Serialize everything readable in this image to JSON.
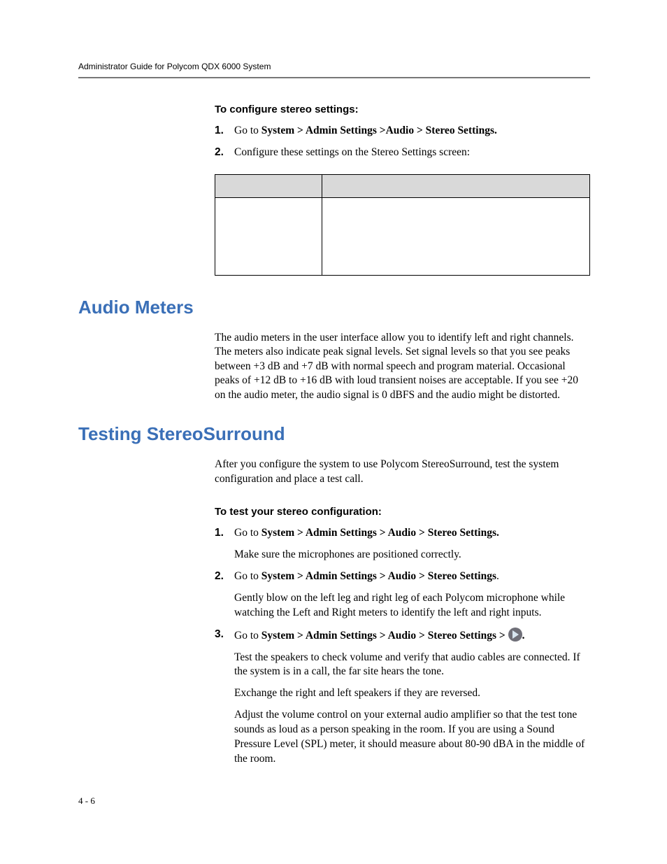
{
  "header": {
    "title": "Administrator Guide for Polycom QDX 6000 System"
  },
  "sec1": {
    "title": "To configure stereo settings:",
    "step1_prefix": "Go to ",
    "step1_path": "System > Admin Settings >Audio > Stereo Settings.",
    "step2": "Configure these settings on the Stereo Settings screen:"
  },
  "audio_meters": {
    "heading": "Audio Meters",
    "para": "The audio meters in the user interface allow you to identify left and right channels. The meters also indicate peak signal levels. Set signal levels so that you see peaks between +3 dB and +7 dB with normal speech and program material. Occasional peaks of +12 dB to +16 dB with loud transient noises are acceptable. If you see +20 on the audio meter, the audio signal is 0 dBFS and the audio might be distorted."
  },
  "testing": {
    "heading": "Testing StereoSurround",
    "intro": "After you configure the system to use Polycom StereoSurround, test the system configuration and place a test call.",
    "sub_heading": "To test your stereo configuration:",
    "s1_prefix": "Go to ",
    "s1_path": "System > Admin Settings > Audio > Stereo Settings.",
    "s1_sub": "Make sure the microphones are positioned correctly.",
    "s2_prefix": "Go to ",
    "s2_path": "System > Admin Settings > Audio > Stereo Settings",
    "s2_suffix": ".",
    "s2_sub": "Gently blow on the left leg and right leg of each Polycom microphone while watching the Left and Right meters to identify the left and right inputs.",
    "s3_prefix": "Go to ",
    "s3_path": "System > Admin Settings > Audio > Stereo Settings > ",
    "s3_suffix": ".",
    "s3_sub1": "Test the speakers to check volume and verify that audio cables are connected. If the system is in a call, the far site hears the tone.",
    "s3_sub2": "Exchange the right and left speakers if they are reversed.",
    "s3_sub3": "Adjust the volume control on your external audio amplifier so that the test tone sounds as loud as a person speaking in the room. If you are using a Sound Pressure Level (SPL) meter, it should measure about 80-90 dBA in the middle of the room."
  },
  "footer": {
    "page": "4 - 6"
  },
  "labels": {
    "n1": "1.",
    "n2": "2.",
    "n3": "3."
  }
}
